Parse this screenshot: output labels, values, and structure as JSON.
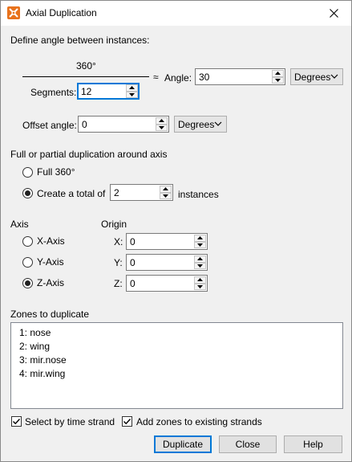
{
  "window": {
    "title": "Axial Duplication",
    "app_icon": "tecplot-icon",
    "close_icon": "close-icon"
  },
  "angle_section": {
    "heading": "Define angle between instances:",
    "numerator": "360°",
    "segments_label": "Segments:",
    "segments_value": "12",
    "approx_symbol": "≈",
    "angle_label": "Angle:",
    "angle_value": "30",
    "angle_unit": "Degrees",
    "offset_label": "Offset angle:",
    "offset_value": "0",
    "offset_unit": "Degrees"
  },
  "duplication_section": {
    "heading": "Full or partial duplication around axis",
    "full_label": "Full 360°",
    "partial_label": "Create a total of",
    "partial_value": "2",
    "partial_suffix": "instances",
    "selected": "partial"
  },
  "axis_section": {
    "heading": "Axis",
    "options": [
      "X-Axis",
      "Y-Axis",
      "Z-Axis"
    ],
    "selected": "Z-Axis"
  },
  "origin_section": {
    "heading": "Origin",
    "x_label": "X:",
    "x_value": "0",
    "y_label": "Y:",
    "y_value": "0",
    "z_label": "Z:",
    "z_value": "0"
  },
  "zones_section": {
    "heading": "Zones to duplicate",
    "items": [
      "1: nose",
      "2: wing",
      "3: mir.nose",
      "4: mir.wing"
    ]
  },
  "options": {
    "select_by_time_strand": "Select by time strand",
    "add_zones_to_strands": "Add zones to existing strands"
  },
  "buttons": {
    "duplicate": "Duplicate",
    "close": "Close",
    "help": "Help"
  }
}
